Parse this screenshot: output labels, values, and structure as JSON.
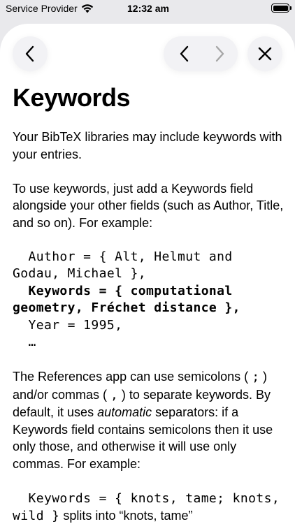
{
  "status_bar": {
    "carrier": "Service Provider",
    "time": "12:32 am"
  },
  "nav": {
    "back_icon": "chevron-left-icon",
    "prev_icon": "chevron-left-icon",
    "next_icon": "chevron-right-icon",
    "close_icon": "close-icon"
  },
  "article": {
    "title": "Keywords",
    "para1": "Your BibTeX libraries may include keywords with your entries.",
    "para2": "To use keywords, just add a Keywords field alongside your other fields (such as Author, Title, and so on). For example:",
    "code1_line1": "  Author = { Alt, Helmut and Godau, Michael },",
    "code1_line2": "  Keywords = { computational geometry, Fréchet distance },",
    "code1_line3": "  Year = 1995,",
    "code1_line4": "  …",
    "para3_a": "The References app can use semicolons ( ",
    "para3_semicolon": ";",
    "para3_b": " ) and/or commas ( ",
    "para3_comma": ",",
    "para3_c": " ) to separate keywords. By default, it uses ",
    "para3_automatic": "automatic",
    "para3_d": " separators: if a Keywords field contains semicolons then it use only those, and otherwise it will use only commas. For example:",
    "code2": "  Keywords = { knots, tame; knots, wild }",
    "code2_tail": " splits into “knots, tame”"
  },
  "colors": {
    "background": "#e9e9ec",
    "sheet": "#ffffff",
    "button": "#f2f2f5",
    "disabled_icon": "#a6a6a6"
  }
}
